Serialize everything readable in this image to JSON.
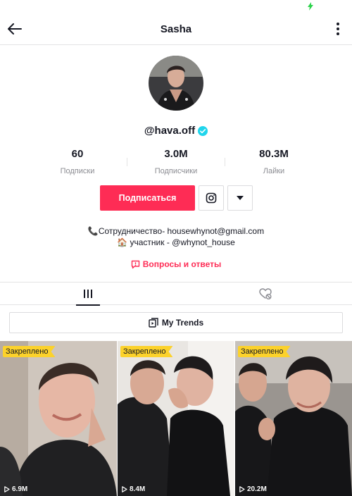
{
  "header": {
    "title": "Sasha"
  },
  "profile": {
    "username": "@hava.off"
  },
  "stats": [
    {
      "value": "60",
      "label": "Подписки"
    },
    {
      "value": "3.0M",
      "label": "Подписчики"
    },
    {
      "value": "80.3M",
      "label": "Лайки"
    }
  ],
  "actions": {
    "follow_label": "Подписаться"
  },
  "bio": {
    "line1": "📞Сотрудничество- housewhynot@gmail.com",
    "line2": "🏠 участник  - @whynot_house"
  },
  "qa": {
    "label": "Вопросы и ответы"
  },
  "trends": {
    "label": "My Trends"
  },
  "videos": [
    {
      "pinned_label": "Закреплено",
      "views": "6.9M"
    },
    {
      "pinned_label": "Закреплено",
      "views": "8.4M"
    },
    {
      "pinned_label": "Закреплено",
      "views": "20.2M"
    }
  ],
  "colors": {
    "accent": "#fe2c55",
    "pin_badge": "#fcd22b",
    "verified": "#20d5ec"
  },
  "icons": [
    "back-arrow-icon",
    "more-vertical-icon",
    "verified-icon",
    "instagram-icon",
    "caret-down-icon",
    "question-icon",
    "grid-icon",
    "liked-hidden-icon",
    "trends-icon",
    "play-icon"
  ]
}
